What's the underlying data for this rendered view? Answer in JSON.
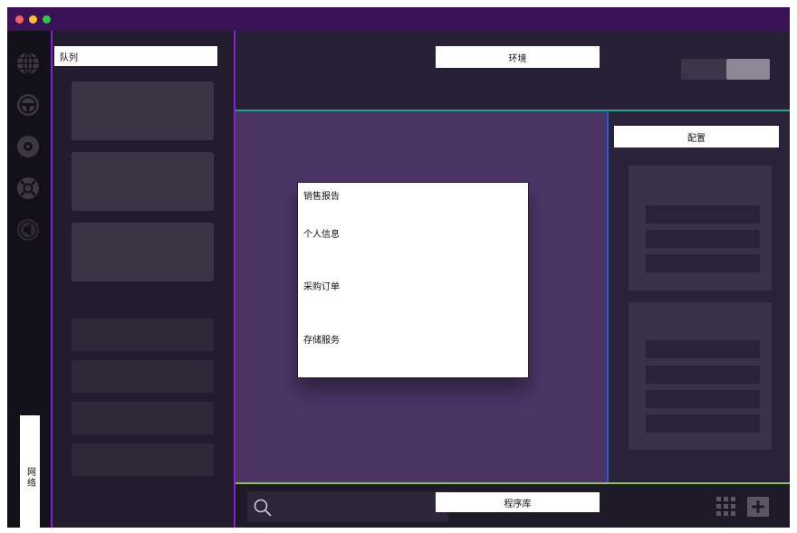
{
  "window": {
    "controls": [
      "close-dot",
      "minimize-dot",
      "maximize-dot"
    ]
  },
  "sidebar": {
    "icons": [
      "globe-icon",
      "steering-wheel-icon",
      "disc-icon",
      "lifebuoy-icon",
      "speaker-icon"
    ],
    "network_label": "网络"
  },
  "queue": {
    "title": "队列"
  },
  "environment": {
    "title": "环境",
    "toggle_on": true
  },
  "menu": {
    "items": [
      "销售报告",
      "个人信息",
      "采购订单",
      "存储服务"
    ]
  },
  "config": {
    "title": "配置"
  },
  "bottom": {
    "program_title": "程序库",
    "icons": [
      "search-icon",
      "grid-icon",
      "plus-icon"
    ]
  },
  "colors": {
    "titlebar": "#3a1257",
    "accent_purple": "#8a1fd1",
    "divider_teal": "#1aa58a",
    "divider_blue": "#2a5bd6",
    "divider_green": "#8cc63f",
    "workspace": "#4b3565"
  }
}
